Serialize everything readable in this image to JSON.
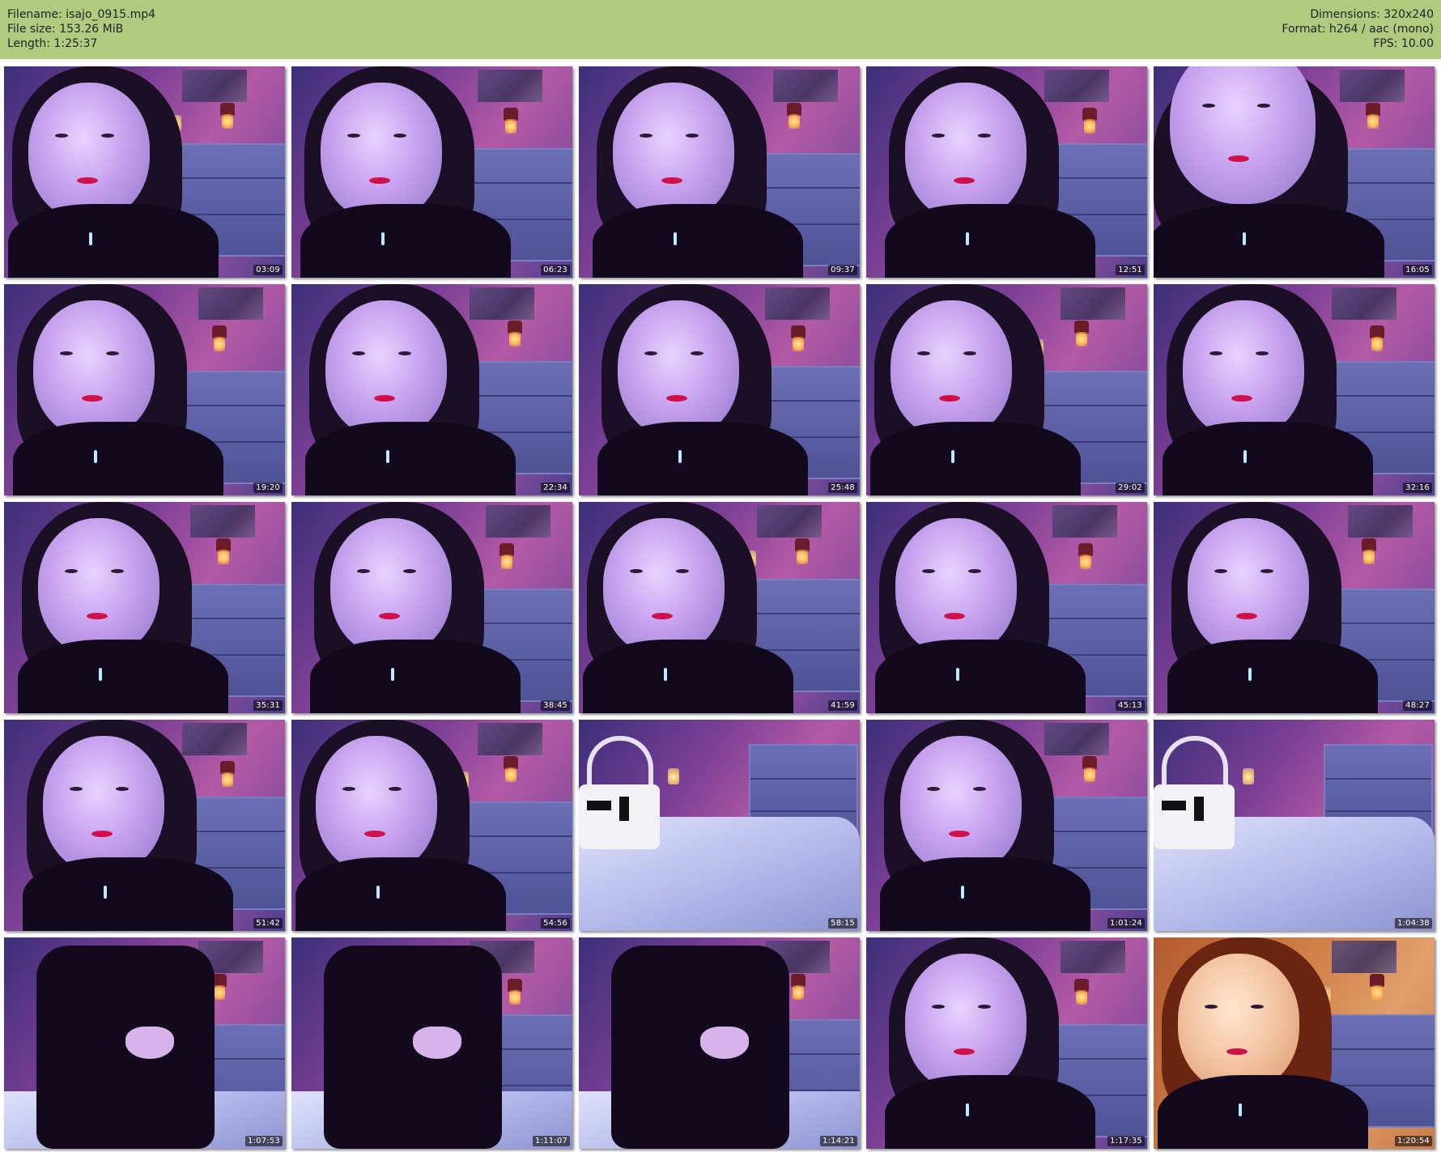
{
  "header": {
    "left": [
      "Filename: isajo_0915.mp4",
      "File size: 153.26 MiB",
      "Length: 1:25:37"
    ],
    "right": [
      "Dimensions: 320x240",
      "Format: h264 / aac (mono)",
      "FPS: 10.00"
    ]
  },
  "thumbnails": [
    {
      "timestamp": "03:09"
    },
    {
      "timestamp": "06:23"
    },
    {
      "timestamp": "09:37"
    },
    {
      "timestamp": "12:51"
    },
    {
      "timestamp": "16:05"
    },
    {
      "timestamp": "19:20"
    },
    {
      "timestamp": "22:34"
    },
    {
      "timestamp": "25:48"
    },
    {
      "timestamp": "29:02"
    },
    {
      "timestamp": "32:16"
    },
    {
      "timestamp": "35:31"
    },
    {
      "timestamp": "38:45"
    },
    {
      "timestamp": "41:59"
    },
    {
      "timestamp": "45:13"
    },
    {
      "timestamp": "48:27"
    },
    {
      "timestamp": "51:42"
    },
    {
      "timestamp": "54:56"
    },
    {
      "timestamp": "58:15"
    },
    {
      "timestamp": "1:01:24"
    },
    {
      "timestamp": "1:04:38"
    },
    {
      "timestamp": "1:07:53"
    },
    {
      "timestamp": "1:11:07"
    },
    {
      "timestamp": "1:14:21"
    },
    {
      "timestamp": "1:17:35"
    },
    {
      "timestamp": "1:20:54"
    }
  ],
  "colors": {
    "header_bg": "#b0cb7f",
    "page_bg": "#ffffff",
    "wall_pink": "#b45aa6",
    "room_blue": "#3a3d8e",
    "warm_orange": "#d2834a"
  }
}
